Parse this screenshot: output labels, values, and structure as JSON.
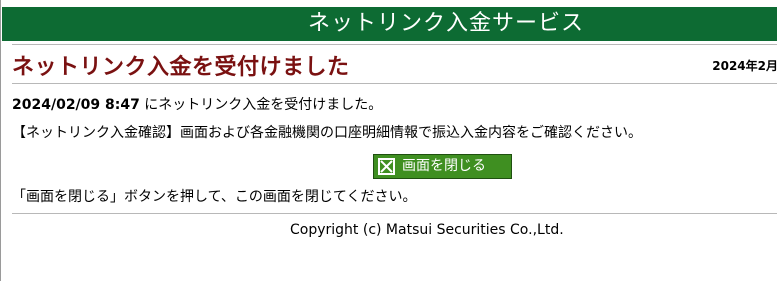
{
  "header": {
    "service_title": "ネットリンク入金サービス"
  },
  "page": {
    "title": "ネットリンク入金を受付けました",
    "date_label": "2024年2月"
  },
  "message": {
    "timestamp": "2024/02/09 8:47",
    "accepted_text": " にネットリンク入金を受付けました。",
    "confirm_text": "【ネットリンク入金確認】画面および各金融機関の口座明細情報で振込入金内容をご確認ください。",
    "close_instruction": "「画面を閉じる」ボタンを押して、この画面を閉じてください。"
  },
  "buttons": {
    "close_label": "画面を閉じる",
    "close_icon": "close-box-icon"
  },
  "footer": {
    "copyright": "Copyright (c) Matsui Securities Co.,Ltd."
  },
  "colors": {
    "banner": "#0d6b33",
    "title": "#7a1111",
    "button": "#3f8f21"
  }
}
